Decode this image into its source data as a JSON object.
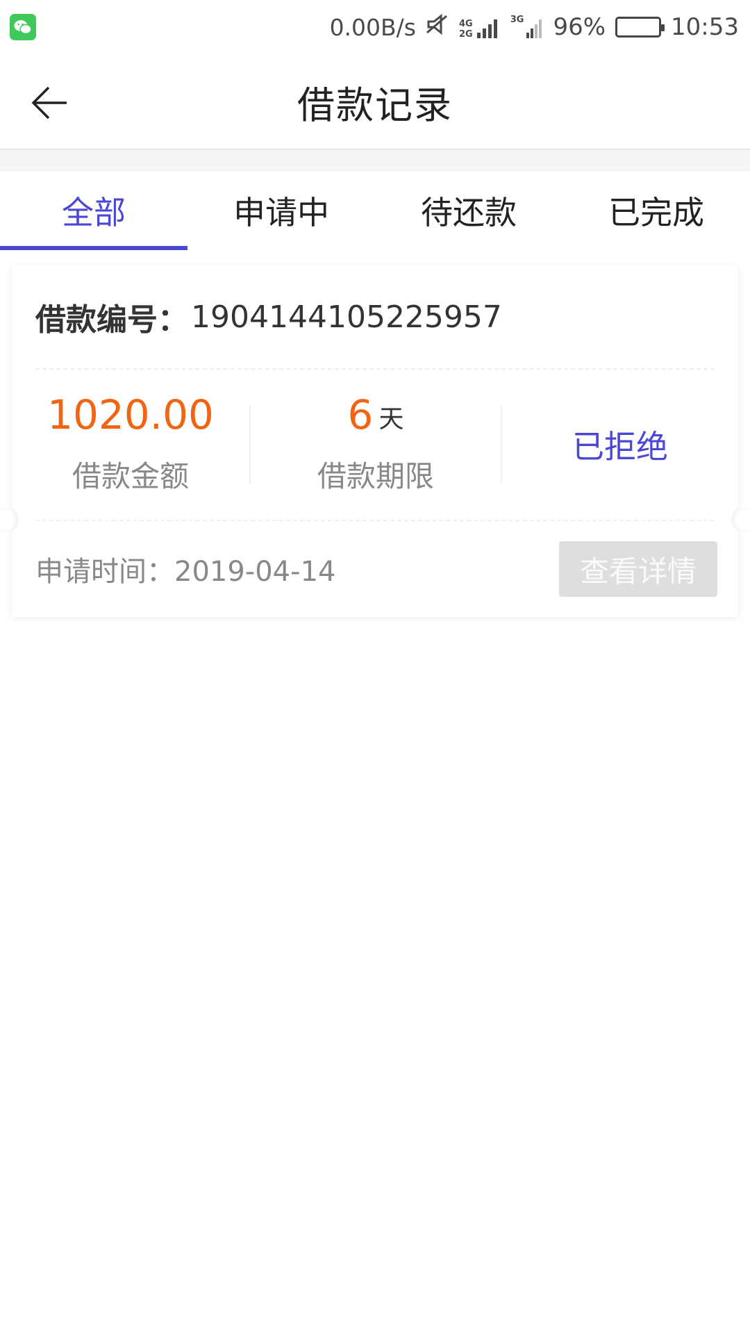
{
  "status_bar": {
    "app_icon": "wechat-icon",
    "net_speed": "0.00B/s",
    "net_label_1": "4G",
    "net_label_2": "2G",
    "net_label_3": "3G",
    "battery": "96%",
    "battery_level": 0.96,
    "time": "10:53"
  },
  "nav": {
    "back_icon": "arrow-left-icon",
    "title": "借款记录"
  },
  "tabs": [
    {
      "label": "全部",
      "active": true
    },
    {
      "label": "申请中",
      "active": false
    },
    {
      "label": "待还款",
      "active": false
    },
    {
      "label": "已完成",
      "active": false
    }
  ],
  "loan_card": {
    "loan_no_label": "借款编号：",
    "loan_no": "1904144105225957",
    "amount": "1020.00",
    "amount_label": "借款金额",
    "term_value": "6",
    "term_unit": "天",
    "term_label": "借款期限",
    "status": "已拒绝",
    "apply_time_label": "申请时间：",
    "apply_time": "2019-04-14",
    "detail_button": "查看详情"
  },
  "colors": {
    "accent": "#4a47d4",
    "amount": "#f06413",
    "muted": "#888888",
    "disabled_button": "#dedede"
  }
}
